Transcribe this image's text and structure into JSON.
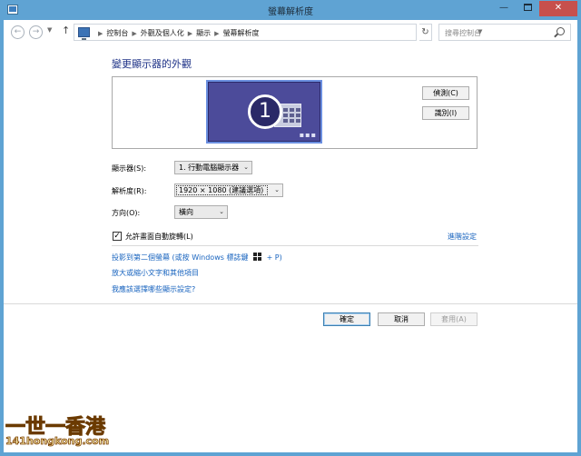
{
  "window": {
    "title": "螢幕解析度"
  },
  "nav": {
    "breadcrumb": [
      "控制台",
      "外觀及個人化",
      "顯示",
      "螢幕解析度"
    ],
    "search_placeholder": "搜尋控制台"
  },
  "main": {
    "heading": "變更顯示器的外觀",
    "monitor_number": "1",
    "detect_label": "偵測(C)",
    "identify_label": "識別(I)",
    "display_label": "顯示器(S):",
    "display_value": "1. 行動電腦顯示器",
    "resolution_label": "解析度(R):",
    "resolution_value": "1920 × 1080 (建議選項)",
    "orientation_label": "方向(O):",
    "orientation_value": "橫向",
    "auto_rotate_label": "允許畫面自動旋轉(L)",
    "auto_rotate_checked": true,
    "advanced_link": "進階設定",
    "project_link_prefix": "投影到第二個螢幕 (或按 Windows 標誌鍵",
    "project_link_suffix": "+ P)",
    "text_size_link": "放大或縮小文字和其他項目",
    "which_settings_link": "我應該選擇哪些顯示設定?"
  },
  "footer": {
    "ok_label": "確定",
    "cancel_label": "取消",
    "apply_label": "套用(A)"
  },
  "watermark": {
    "name": "一世一香港",
    "url": "141hongkong.com"
  },
  "colors": {
    "frame": "#5fa3d3",
    "heading": "#1e3287",
    "link": "#1964bf",
    "close_button": "#c7504c",
    "monitor": "#4c4b9a"
  }
}
